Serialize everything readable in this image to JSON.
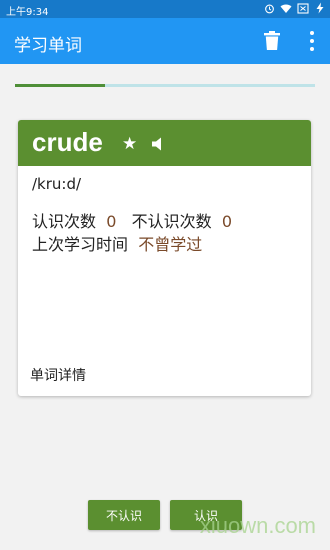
{
  "status_bar": {
    "time": "上午9:34",
    "icons": [
      "alarm-icon",
      "wifi-icon",
      "sim-icon",
      "battery-icon"
    ]
  },
  "app_bar": {
    "title": "学习单词",
    "actions": [
      "trash-icon",
      "more-vert-icon"
    ]
  },
  "progress": {
    "value": 0.3
  },
  "card": {
    "word": "crude",
    "phonetic": "/kru:d/",
    "known_label": "认识次数",
    "known_count": "0",
    "unknown_label": "不认识次数",
    "unknown_count": "0",
    "last_study_label": "上次学习时间",
    "last_study_value": "不曾学过",
    "details_label": "单词详情"
  },
  "buttons": {
    "unknown_label": "不认识",
    "known_label": "认识"
  },
  "watermark": "xiuown.com",
  "colors": {
    "status_bar": "#1779c9",
    "app_bar": "#2196f3",
    "accent_green": "#5b8f30",
    "progress_fill": "#4f8f38",
    "progress_track": "#bfe3e8",
    "value_brown": "#7a4a2a"
  }
}
